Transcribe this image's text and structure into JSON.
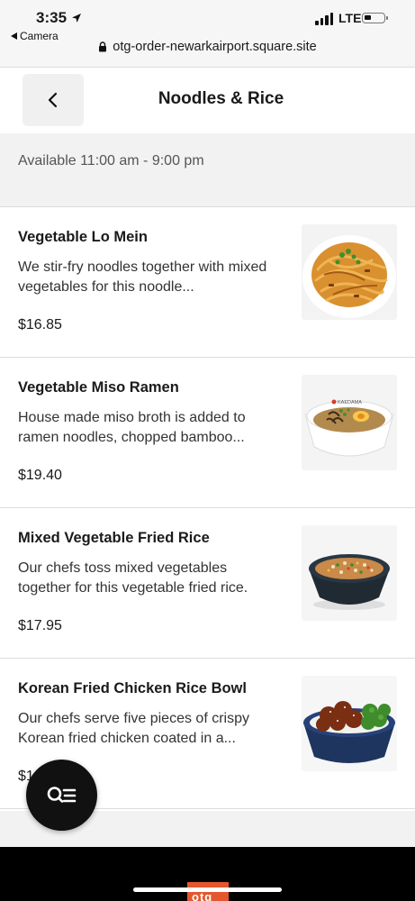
{
  "status": {
    "time": "3:35",
    "back_app": "Camera",
    "network": "LTE",
    "url": "otg-order-newarkairport.square.site"
  },
  "header": {
    "title": "Noodles & Rice"
  },
  "availability": "Available 11:00 am - 9:00 pm",
  "items": [
    {
      "name": "Vegetable Lo Mein",
      "description": "We stir-fry noodles together with mixed vegetables for this noodle...",
      "price": "$16.85"
    },
    {
      "name": "Vegetable Miso Ramen",
      "description": "House made miso broth is added to ramen noodles, chopped bamboo...",
      "price": "$19.40",
      "bowl_label": "KAEDAMA"
    },
    {
      "name": "Mixed Vegetable Fried Rice",
      "description": "Our chefs toss mixed vegetables together for this vegetable fried rice.",
      "price": "$17.95"
    },
    {
      "name": "Korean Fried Chicken Rice Bowl",
      "description": "Our chefs serve five pieces of crispy Korean fried chicken coated in a...",
      "price": "$1"
    }
  ],
  "footer_logo": "otg",
  "icons": {
    "location_arrow": "location-arrow-icon",
    "back": "chevron-left-icon",
    "lock": "lock-icon",
    "search_menu": "search-menu-icon"
  }
}
